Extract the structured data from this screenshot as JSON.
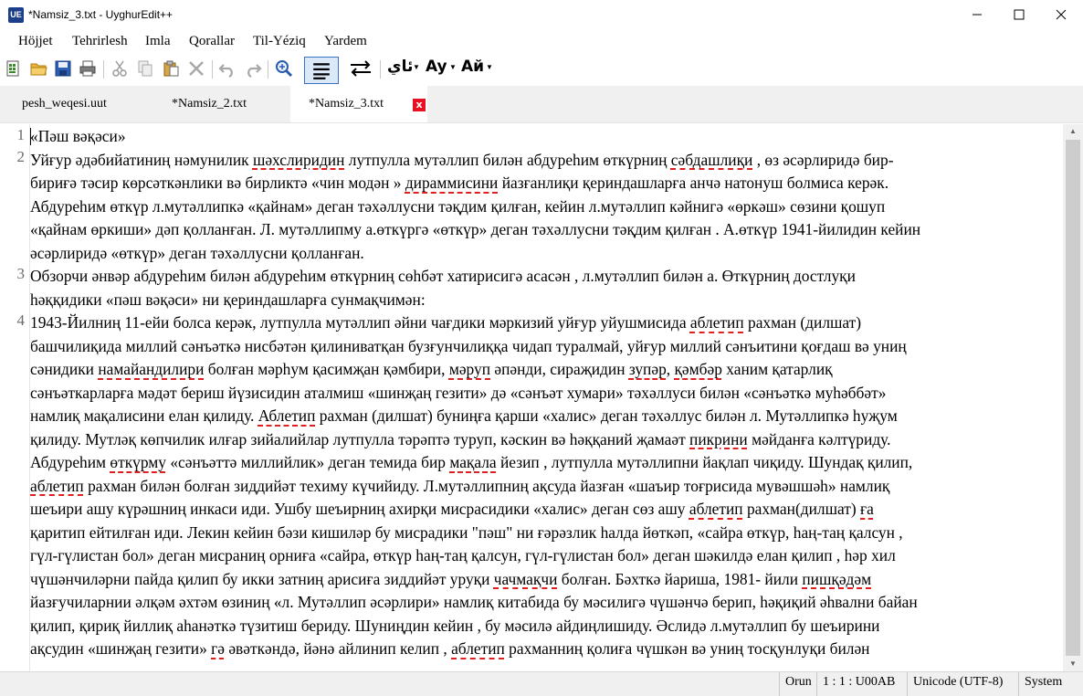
{
  "window": {
    "icon_label": "UE",
    "title": "*Namsiz_3.txt - UyghurEdit++"
  },
  "menu": {
    "items": [
      "Höjjet",
      "Tehrirlesh",
      "Imla",
      "Qorallar",
      "Til-Yéziq",
      "Yardem"
    ]
  },
  "toolbar": {
    "font_label": "ئاي",
    "case_label": "Ay",
    "cyr_label": "Ай"
  },
  "tabs": [
    {
      "label": "pesh_weqesi.uut"
    },
    {
      "label": "*Namsiz_2.txt"
    },
    {
      "label": "*Namsiz_3.txt",
      "close": "x"
    }
  ],
  "editor": {
    "line_numbers": [
      "1",
      "2",
      "3",
      "4"
    ],
    "lines": [
      [
        "«Пәш вәқәси»"
      ],
      [
        "Уйғур әдәбийатиниң нәмунилик ",
        {
          "w": "шәхслиридин"
        },
        " лутпулла мутәллип билән абдуреһим өткүрниң ",
        {
          "w": "сәбдашлиқи"
        },
        " , өз әсәрлиридә бир-"
      ],
      [
        "бириғә тәсир көрсәткәнлики вә бирликтә «чин модән » ",
        {
          "w": "дираммисини"
        },
        " йазғанлиқи қериндашларға анчә натонуш болмиса керәк."
      ],
      [
        "Абдуреһим өткүр л.мутәллипкә «қайнам» деган тәхәллусни тәқдим қилған, кейин л.мутәллип кәйнигә «өркәш» сөзини қошуп"
      ],
      [
        "«қайнам өркиши» дәп қолланған. Л. мутәллипму а.өткүргә «өткүр» деган тәхәллусни тәқдим қилған . А.өткүр 1941-йилидин кейин"
      ],
      [
        "әсәрлиридә «өткүр» деган тәхәллусни қолланған."
      ],
      [
        "Обзорчи әнвәр абдуреһим билән абдуреһим өткүрниң сөһбәт хатирисигә асасән , л.мутәллип билән а. Өткүрниң достлуқи"
      ],
      [
        "һәққидики «пәш вәқәси» ни қериндашларға сунмақчимән:"
      ],
      [
        "1943-Йилниң 11-ейи болса керәк, лутпулла мутәллип әйни чағдики мәркизий уйғур уйушмисида ",
        {
          "w": "аблетип"
        },
        " рахман (дилшат)"
      ],
      [
        "башчилиқида миллий сәнъәткә нисбәтән қилиниватқан бузғунчилиққа чидап туралмай, уйғур миллий сәнъитини қоғдаш вә униң"
      ],
      [
        "сәнидики ",
        {
          "w": "намайандилири"
        },
        " болған мәрһум қасимҗан қәмбири, ",
        {
          "w": "мәруп"
        },
        " әпәнди, сираҗидин ",
        {
          "w": "зупәр"
        },
        ", ",
        {
          "w": "қәмбәр"
        },
        " ханим қатарлиқ"
      ],
      [
        "сәнъәткарларға мәдәт бериш йүзисидин аталмиш «шинҗаң гезити» дә «сәнъәт хумари» тәхәллуси билән «сәнъәткә муһәббәт»"
      ],
      [
        "намлиқ мақалисини елан қилиду. ",
        {
          "w": "Аблетип"
        },
        " рахман (дилшат) буниңға қарши «халис» деган тәхәллус билән л. Мутәллипкә һуҗум"
      ],
      [
        "қилиду. Мутләқ көпчилик илғар зийалийлар лутпулла тәрәптә туруп, кәскин вә һәққаний җамаәт ",
        {
          "w": "пикрини"
        },
        " мәйданға кәлтүриду."
      ],
      [
        "Абдуреһим ",
        {
          "w": "өткүрму"
        },
        " «сәнъәттә миллийлик» деган темида бир ",
        {
          "w": "мақала"
        },
        " йезип , лутпулла мутәллипни йақлап чиқиду. Шундақ қилип,"
      ],
      [
        {
          "w": "аблетип"
        },
        " рахман билән болған зиддийәт техиму күчийиду. Л.мутәллипниң ақсуда йазған «шаъир тоғрисида мувәшшәһ» намлиқ"
      ],
      [
        "шеъири ашу күрәшниң инкаси иди. Ушбу шеъирниң ахирқи мисрасидики «халис» деган сөз ашу ",
        {
          "w": "аблетип"
        },
        " рахман(дилшат) ",
        {
          "w": "ға"
        }
      ],
      [
        "қаритип ейтилған иди. Лекин кейин бәзи кишиләр бу мисрадики \"пәш\" ни ғәрәзлик һалда йөткәп, «сайра өткүр, һаң-таң қалсун ,"
      ],
      [
        "гүл-гүлистан бол» деган мисраниң орниға «сайра, өткүр һаң-таң қалсун, гүл-гүлистан бол» деган шәкилдә елан қилип , һәр хил"
      ],
      [
        "чүшәнчиләрни пайда қилип бу икки затниң арисиға зиддийәт уруқи ",
        {
          "w": "чачмақчи"
        },
        " болған. Бәхткә йариша, 1981- йили ",
        {
          "w": "пишқәдәм"
        }
      ],
      [
        "йазғучиларнии әлқәм әхтәм өзиниң «л. Мутәллип әсәрлири» намлиқ китабида бу мәсилигә чүшәнчә берип, һәқиқий әһвални байан"
      ],
      [
        "қилип, қириқ йиллиқ аһанәткә түзитиш бериду. Шуниңдин кейин , бу мәсилә айдиңлишиду. Әслидә л.мутәллип бу шеъирини"
      ],
      [
        "ақсудин «шинҗаң гезити» ",
        {
          "w": "гә"
        },
        " әвәткәндә, йәнә айлинип келип , ",
        {
          "w": "аблетип"
        },
        " рахманниң қолиға чүшкән вә униң тосқунлуқи билән"
      ]
    ]
  },
  "statusbar": {
    "cells": [
      "Orun",
      "1 : 1 : U00AB",
      "Unicode (UTF-8)",
      "System"
    ]
  }
}
